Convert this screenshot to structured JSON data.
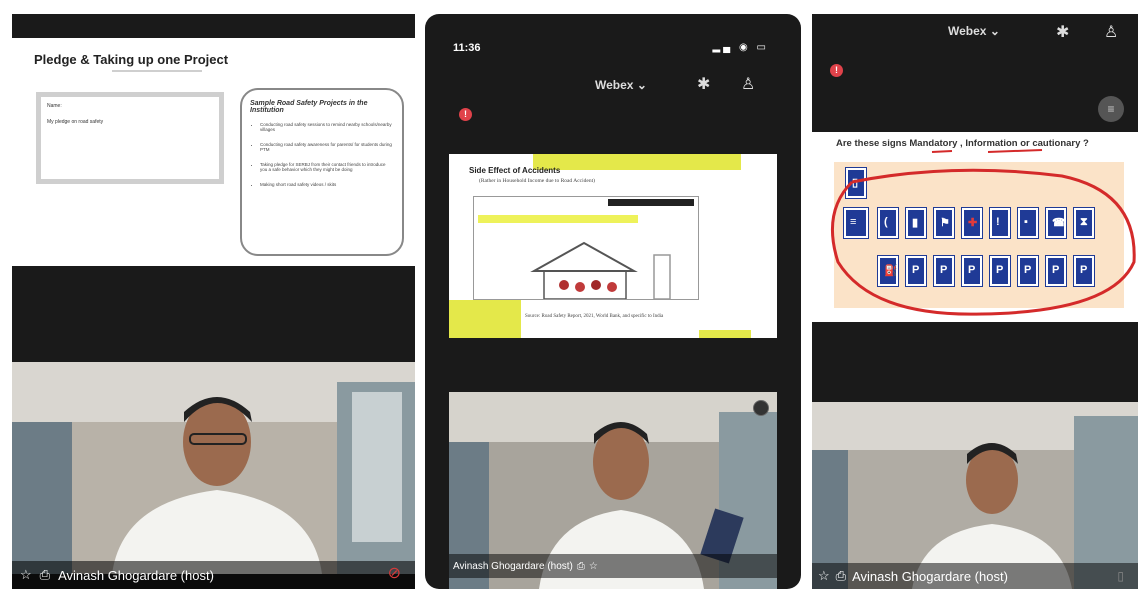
{
  "panel1": {
    "slide_title": "Pledge & Taking up one Project",
    "box_name": "Name:",
    "box_value": "My pledge on road safety",
    "suggestions_heading": "Sample Road Safety Projects in the Institution",
    "suggestions": [
      "Conducting road safety sessions to remind nearby schools/nearby villages",
      "Conducting road safety awareness for parents/ for students during PTM",
      "Taking pledge for SERBJ from their contact friends to introduce you a safe behavior which they might be doing",
      "Making short road safety videos / skits"
    ],
    "presenter_name": "Avinash Ghogardare (host)"
  },
  "panel2": {
    "time": "11:36",
    "app_title": "Webex",
    "slide_title": "Side Effect of Accidents",
    "slide_subtitle": "(Rather in Household Income due to Road Accident)",
    "slide_footer": "Source: Road Safety Report, 2021, World Bank, and specific to India",
    "presenter_name": "Avinash Ghogardare (host)"
  },
  "panel3": {
    "app_title": "Webex",
    "slide_question": "Are these signs Mandatory , Information or cautionary ?",
    "presenter_name": "Avinash Ghogardare (host)"
  },
  "colors": {
    "highlight_yellow": "#e4e84a",
    "alert_red": "#e0424a",
    "sign_blue": "#1f3a96",
    "annotation_red": "#d42a2a"
  }
}
